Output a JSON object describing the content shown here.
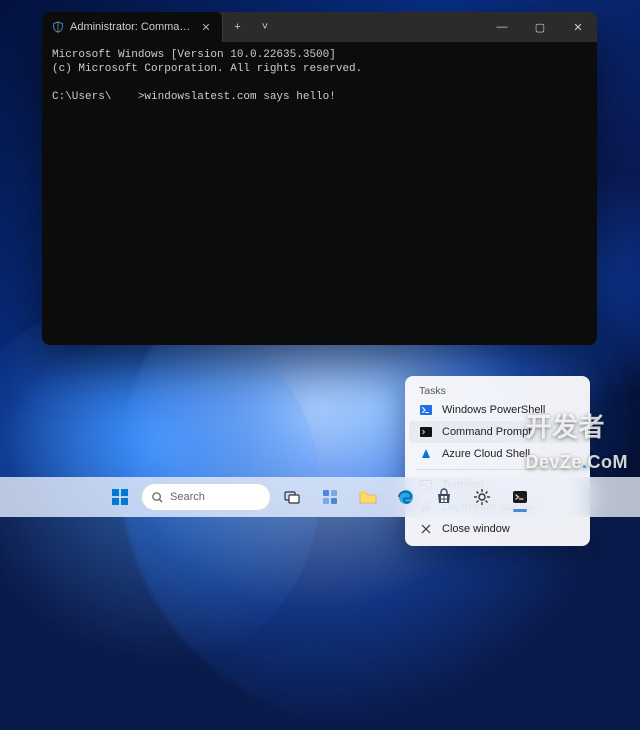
{
  "window": {
    "tab_title": "Administrator: Command Pro",
    "new_tab_glyph": "+",
    "dropdown_glyph": "˅",
    "min_glyph": "—",
    "max_glyph": "▢",
    "close_glyph": "✕",
    "tab_close_glyph": "✕"
  },
  "terminal": {
    "line1": "Microsoft Windows [Version 10.0.22635.3500]",
    "line2": "(c) Microsoft Corporation. All rights reserved.",
    "blank": "",
    "line3": "C:\\Users\\    >windowslatest.com says hello!"
  },
  "jump": {
    "section": "Tasks",
    "items": {
      "ps": "Windows PowerShell",
      "cmd": "Command Prompt",
      "az": "Azure Cloud Shell",
      "term": "Terminal",
      "unpin": "Unpin from taskbar",
      "close": "Close window"
    }
  },
  "taskbar": {
    "search_placeholder": "Search"
  },
  "watermark": {
    "a": "开发者",
    "b": "DevZe",
    "c": "CoM"
  }
}
